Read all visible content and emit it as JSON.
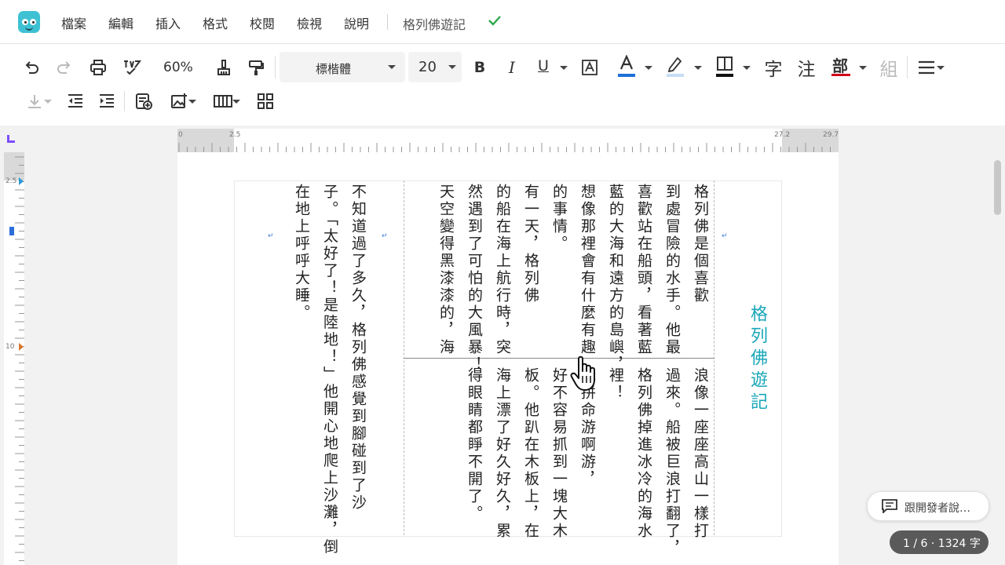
{
  "menu": {
    "items": [
      "檔案",
      "編輯",
      "插入",
      "格式",
      "校閱",
      "檢視",
      "說明"
    ],
    "doc_title": "格列佛遊記"
  },
  "toolbar": {
    "zoom": "60%",
    "font": "標楷體",
    "size": "20",
    "char_button": "字",
    "annotate_button": "注",
    "radical_button": "部",
    "group_button": "組"
  },
  "ruler": {
    "h_labels": [
      "0",
      "2.5",
      "27.2",
      "29.7"
    ],
    "v_labels": [
      "2.5",
      "10"
    ]
  },
  "page": {
    "title": "格列佛遊記",
    "upper_columns": [
      "格列佛是個喜歡",
      "到處冒險的水手。他最",
      "喜歡站在船頭，看著藍",
      "藍的大海和遠方的島嶼，",
      "想像那裡會有什麼有趣",
      "的事情。",
      "有一天，格列佛",
      "的船在海上航行時，突",
      "然遇到了可怕的大風暴！",
      "天空變得黑漆漆的，海"
    ],
    "left_columns": [
      "不知道過了多久，格列佛感覺到腳碰到了沙",
      "子。「太好了！是陸地！」他開心地爬上沙灘，倒",
      "在地上呼呼大睡。"
    ],
    "lower_columns": [
      "浪像一座座高山一樣打",
      "過來。船被巨浪打翻了，",
      "格列佛掉進冰冷的海水",
      "裡！",
      "他拼命游啊游，",
      "好不容易抓到一塊大木",
      "板。他趴在木板上，在",
      "海上漂了好久好久，累",
      "得眼睛都睜不開了。"
    ]
  },
  "feedback": {
    "label": "跟開發者說…"
  },
  "status": {
    "label": "1 / 6 · 1324 字"
  },
  "colors": {
    "accent": "#1aa7b8",
    "font_color_bar": "#1e6fd9",
    "radical_bar": "#d0021b",
    "check": "#2ea84b"
  }
}
